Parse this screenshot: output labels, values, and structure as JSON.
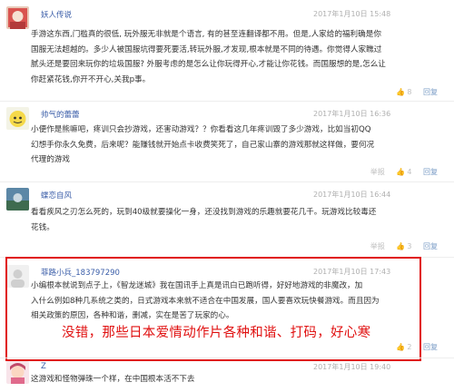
{
  "comments": [
    {
      "username": "妖人传说",
      "timestamp": "2017年1月10日 15:48",
      "lines": [
        "手游这东西,门槛真的很低, 玩外服无非就是个语言, 有的甚至连翻译都不用。但是,人家给的福利确是你",
        "国服无法超越的。多少人被国服坑得要死要活,转玩外服,才发现,根本就是不同的待遇。你觉得人家瞧过",
        "腻头还是要回来玩你的垃圾国服? 外服考虑的是怎么让你玩得开心,才能让你花钱。而国服想的是,怎么让",
        "你赶紧花钱,你开不开心,关我p事。"
      ],
      "actions": [
        "8",
        "回复"
      ]
    },
    {
      "username": "帅气的蕾蕾",
      "timestamp": "2017年1月10日 16:36",
      "lines": [
        "小便作是熊嘛吧，疼训只会抄游戏，还害动游戏？？你看看这几年疼训毁了多少游戏，比如当初QQ",
        "幻想手你永久免费，后来呢？能赚钱就开始点卡收费笑死了，自己家山寨的游戏那就这样做，要何况",
        "代理的游戏"
      ],
      "actions": [
        "举报",
        "4",
        "回复"
      ]
    },
    {
      "username": "蝶恋自风",
      "timestamp": "2017年1月10日 16:44",
      "lines": [
        "看看疾风之刃怎么死的，玩到40级就要操化一身，还没找到游戏的乐趣就要花几千。玩游戏比较毒还",
        "花钱。"
      ],
      "actions": [
        "举报",
        "3",
        "回复"
      ]
    },
    {
      "username": "菲路小兵_183797290",
      "timestamp": "2017年1月10日 17:43",
      "lines": [
        "小编根本就说到点子上，《智龙迷城》我在国讯手上真是讯白已跑听得，好好地游戏的非魔改，加",
        "入什么例如8种几系统之类的，日式游戏本来就不适合在中国发展，国人要喜欢玩快餐游戏。而且因为",
        "相关政策的原因，各种和谐，删减，实在是苦了玩家的心。"
      ],
      "actions": [
        "2",
        "回复"
      ]
    },
    {
      "username": "Z",
      "timestamp": "2017年1月10日 19:40",
      "lines": [
        "这游戏和怪物弹珠一个样，在中国根本活不下去"
      ],
      "actions": []
    }
  ],
  "overlay": {
    "text": "没错，那些日本爱情动作片各种和谐、打码，好心寒"
  },
  "colors": {
    "highlight": "#e01010",
    "username": "#3a5da8",
    "timestamp": "#b0b0b0"
  }
}
